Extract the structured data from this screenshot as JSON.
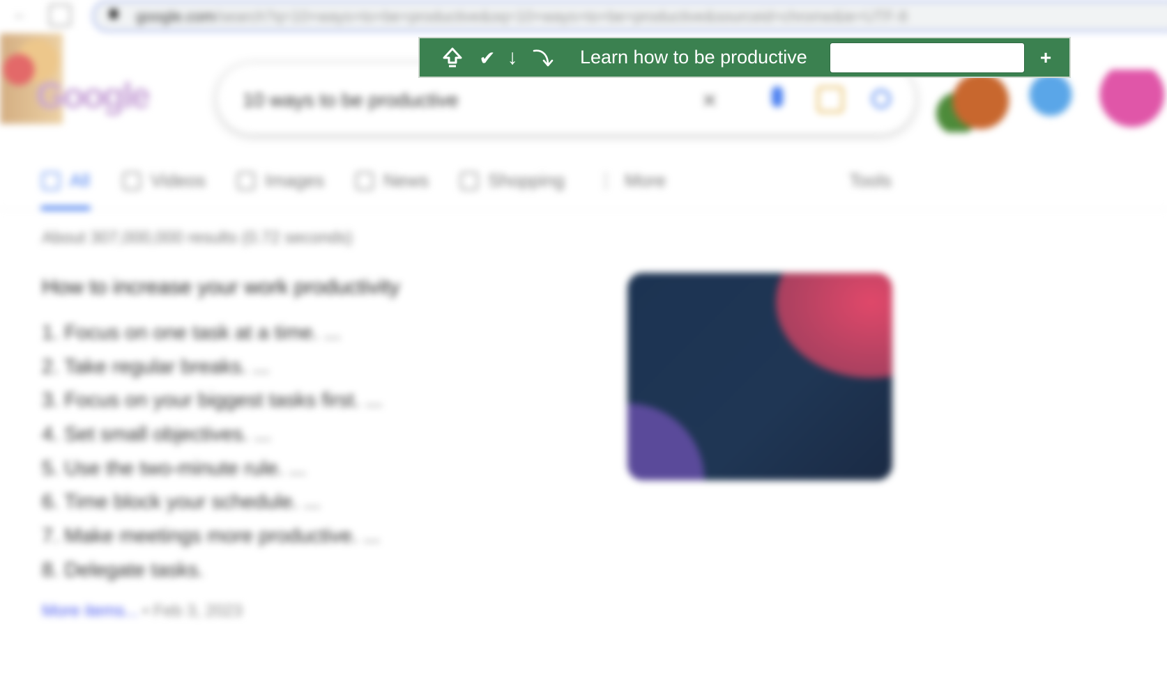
{
  "browser": {
    "url_domain": "google.com",
    "url_rest": "/search?q=10+ways+to+be+productive&oq=10+ways+to+be+productive&sourceid=chrome&ie=UTF-8"
  },
  "search": {
    "logo_text": "Google",
    "query": "10 ways to be productive",
    "clear_glyph": "✕"
  },
  "tabs": {
    "items": [
      {
        "label": "All"
      },
      {
        "label": "Videos"
      },
      {
        "label": "Images"
      },
      {
        "label": "News"
      },
      {
        "label": "Shopping"
      },
      {
        "label": "More"
      }
    ],
    "tools_label": "Tools"
  },
  "results": {
    "stats": "About 307,000,000 results (0.72 seconds)",
    "answer_title": "How to increase your work productivity",
    "steps": [
      "1. Focus on one task at a time. ...",
      "2. Take regular breaks. ...",
      "3. Focus on your biggest tasks first. ...",
      "4. Set small objectives. ...",
      "5. Use the two-minute rule. ...",
      "6. Time block your schedule. ...",
      "7. Make meetings more productive. ...",
      "8. Delegate tasks."
    ],
    "more_link": "More items...",
    "date": "• Feb 3, 2023"
  },
  "toolbar": {
    "colors": {
      "background": "#3b8150",
      "text": "#ffffff"
    },
    "home_icon": "home-up-icon",
    "check_glyph": "✔",
    "down_glyph": "↓",
    "redo_icon": "redo-curve-icon",
    "goal_label": "Learn how to be productive",
    "input_value": "",
    "add_glyph": "+"
  }
}
